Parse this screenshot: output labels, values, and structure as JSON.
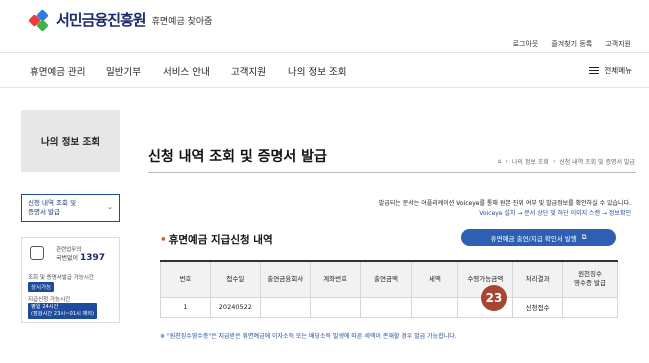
{
  "header": {
    "logo_text": "서민금융진흥원",
    "logo_sub": "휴면예금 찾아줌",
    "top_links": [
      "로그아웃",
      "즐겨찾기 등록",
      "고객지원"
    ]
  },
  "gnb": {
    "items": [
      "휴면예금 관리",
      "일반기부",
      "서비스 안내",
      "고객지원",
      "나의 정보 조회"
    ],
    "all_menu": "전체메뉴"
  },
  "sidebar": {
    "title": "나의 정보 조회",
    "menu_line1": "신청 내역 조회 및",
    "menu_line2": "증명서 발급",
    "contact": {
      "line1": "관련업무의",
      "line2_prefix": "국번없이",
      "number": "1397",
      "line3": "조회 및 증명서발급 가능시간",
      "badge1": "상시가능",
      "line4": "지급신청 가능시간",
      "badge2_line1": "평일 24시간",
      "badge2_line2": "(점검시간 23시~01시 제외)"
    }
  },
  "main": {
    "title": "신청 내역 조회 및 증명서 발급",
    "breadcrumb": [
      "나의 정보 조회",
      "신청 내역 조회 및 증명서 발급"
    ],
    "notice1": "발급되는 문서는 어플리케이션 Voiceye를 통해 원본 진위 여부 및 발급정보를 확인하실 수 있습니다.",
    "notice2": "Voiceye 설치 → 문서 상단 및 하단 이미지 스캔 → 정보확인",
    "section_title": "휴면예금 지급신청 내역",
    "proof_button": "휴면예금 출연/지급 확인서 발행",
    "table": {
      "headers": [
        "번호",
        "접수일",
        "출연금융회사",
        "계좌번호",
        "출연금액",
        "세액",
        "수령가능금액",
        "처리결과",
        "원천징수\n영수증 발급"
      ],
      "rows": [
        [
          "1",
          "20240522",
          "",
          "",
          "",
          "",
          "",
          "신청접수",
          ""
        ]
      ]
    },
    "step_badge": "23",
    "foot_note": "※ \"원천징수영수증\"은 지급받은 휴면예금에 이자소득 또는 배당소득 발생에 따른 세액이 존재할 경우 발급 가능합니다."
  },
  "colors": {
    "brand_navy": "#1b2a6b",
    "button_blue": "#2e5fb3",
    "badge_red": "#a84432"
  }
}
